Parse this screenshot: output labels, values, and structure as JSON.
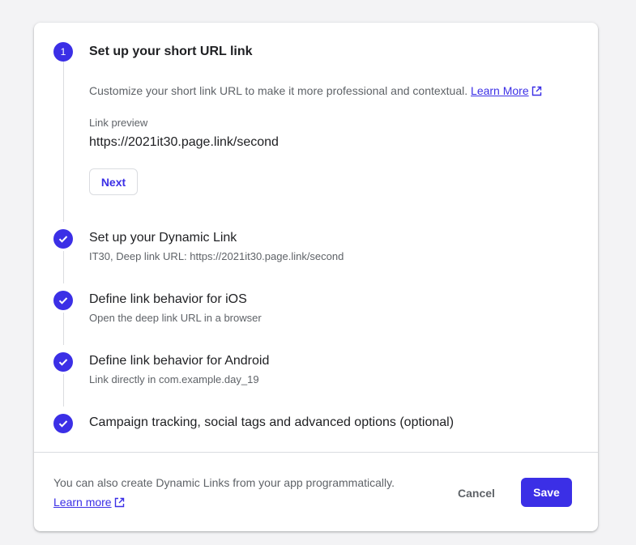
{
  "colors": {
    "accent": "#3b2fe6",
    "text_primary": "#202124",
    "text_secondary": "#5f6368",
    "divider": "#dadce0"
  },
  "steps": [
    {
      "number": "1",
      "state": "active",
      "title": "Set up your short URL link",
      "description": "Customize your short link URL to make it more professional and contextual.",
      "learn_more": "Learn More",
      "preview_label": "Link preview",
      "preview_value": "https://2021it30.page.link/second",
      "next_label": "Next"
    },
    {
      "state": "complete",
      "icon": "check-icon",
      "title": "Set up your Dynamic Link",
      "subtitle": "IT30, Deep link URL: https://2021it30.page.link/second"
    },
    {
      "state": "complete",
      "icon": "check-icon",
      "title": "Define link behavior for iOS",
      "subtitle": "Open the deep link URL in a browser"
    },
    {
      "state": "complete",
      "icon": "check-icon",
      "title": "Define link behavior for Android",
      "subtitle": "Link directly in com.example.day_19"
    },
    {
      "state": "complete",
      "icon": "check-icon",
      "title": "Campaign tracking, social tags and advanced options (optional)"
    }
  ],
  "footer": {
    "text": "You can also create Dynamic Links from your app programmatically.",
    "learn_more": "Learn more",
    "cancel_label": "Cancel",
    "save_label": "Save"
  }
}
